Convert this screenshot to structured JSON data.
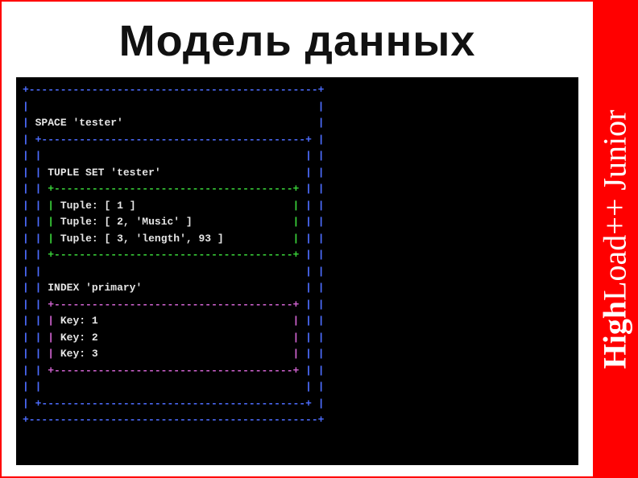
{
  "title": "Модель данных",
  "sidebar": {
    "high": "High",
    "rest": "Load++ Junior"
  },
  "space": {
    "label": "SPACE",
    "name": "'tester'"
  },
  "tuple_set": {
    "label": "TUPLE SET",
    "name": "'tester'",
    "rows": [
      "Tuple: [ 1 ]",
      "Tuple: [ 2, 'Music' ]",
      "Tuple: [ 3, 'length', 93 ]"
    ]
  },
  "index": {
    "label": "INDEX",
    "name": "'primary'",
    "rows": [
      "Key: 1",
      "Key: 2",
      "Key: 3"
    ]
  }
}
